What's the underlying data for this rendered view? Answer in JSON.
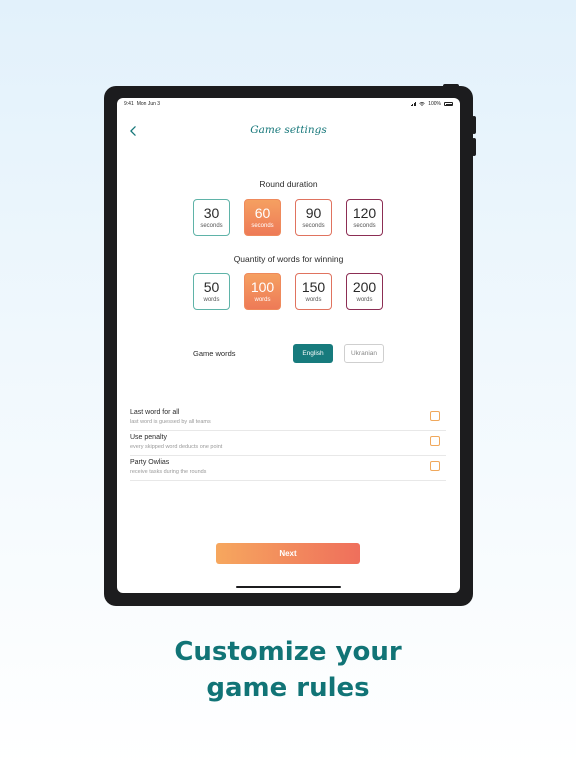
{
  "status_bar": {
    "time": "9:41",
    "date": "Mon Jun 3",
    "battery": "100%"
  },
  "header": {
    "title": "Game settings"
  },
  "round_duration": {
    "label": "Round duration",
    "options": [
      {
        "value": "30",
        "unit": "seconds",
        "color": "#5fb3a8"
      },
      {
        "value": "60",
        "unit": "seconds",
        "color": "#ef8a5c"
      },
      {
        "value": "90",
        "unit": "seconds",
        "color": "#e0735f"
      },
      {
        "value": "120",
        "unit": "seconds",
        "color": "#8c2e54"
      }
    ],
    "selected_value": "60"
  },
  "words_to_win": {
    "label": "Quantity of words for winning",
    "options": [
      {
        "value": "50",
        "unit": "words",
        "color": "#5fb3a8"
      },
      {
        "value": "100",
        "unit": "words",
        "color": "#ef8a5c"
      },
      {
        "value": "150",
        "unit": "words",
        "color": "#e0735f"
      },
      {
        "value": "200",
        "unit": "words",
        "color": "#8c2e54"
      }
    ],
    "selected_value": "100"
  },
  "game_words": {
    "label": "Game words",
    "active_option": "English",
    "inactive_option": "Ukranian"
  },
  "settings": [
    {
      "title": "Last word for all",
      "subtitle": "last word is guessed by all teams",
      "checked": false
    },
    {
      "title": "Use penalty",
      "subtitle": "every skipped word deducts one point",
      "checked": false
    },
    {
      "title": "Party Owlias",
      "subtitle": "receive tasks during the rounds",
      "checked": false
    }
  ],
  "next_button": {
    "label": "Next"
  },
  "headline": {
    "line1": "Customize your",
    "line2": "game rules"
  },
  "colors": {
    "accent_teal": "#177b7d",
    "accent_orange": "#f09a5e",
    "checkbox_border": "#f0a85c"
  }
}
